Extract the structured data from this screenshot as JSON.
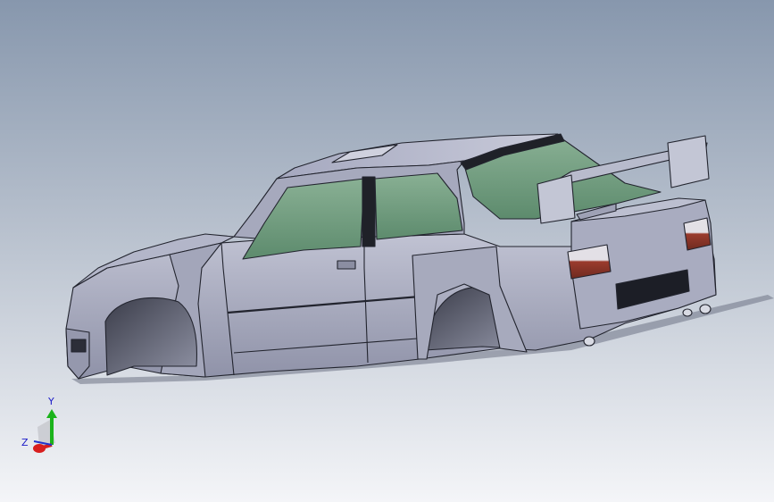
{
  "viewport": {
    "background_top": "#8a9bb0",
    "background_bottom": "#f2f4f7",
    "body_color": "#9ea2b8",
    "glass_color": "#6e9a7e",
    "taillight_color": "#8c3a2e"
  },
  "triad": {
    "y_label": "Y",
    "z_label": "Z",
    "y_color": "#1bb31b",
    "x_color": "#d81e1e",
    "z_color": "#2233cc"
  }
}
